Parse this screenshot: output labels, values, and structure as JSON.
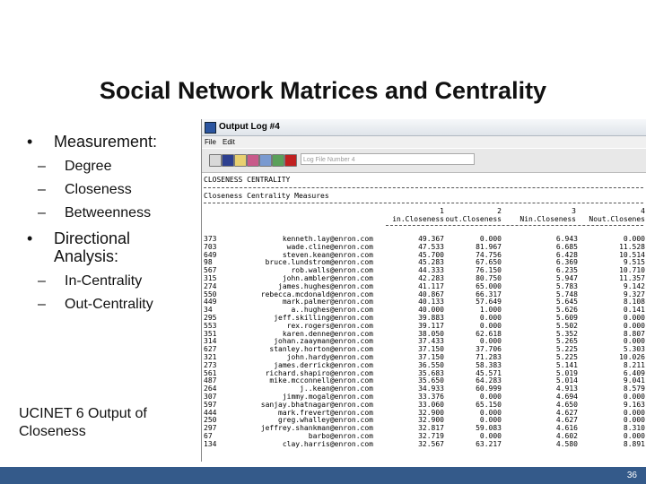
{
  "slide": {
    "title": "Social Network Matrices and Centrality",
    "bullets": [
      {
        "text": "Measurement:",
        "subs": [
          "Degree",
          "Closeness",
          "Betweenness"
        ]
      },
      {
        "text": "Directional Analysis:",
        "subs": [
          "In-Centrality",
          "Out-Centrality"
        ]
      }
    ],
    "caption": "UCINET 6 Output of Closeness",
    "page_number": "36",
    "bullet_glyph": "•",
    "dash_glyph": "–"
  },
  "window": {
    "title": "Output Log #4",
    "menu": [
      "File",
      "Edit"
    ],
    "log_field_placeholder": "Log File Number 4",
    "heading1": "CLOSENESS CENTRALITY",
    "heading2": "Closeness Centrality Measures",
    "column_numbers": [
      "1",
      "2",
      "3",
      "4"
    ],
    "columns": [
      "in.Closeness",
      "out.Closeness",
      "Nin.Closeness",
      "Nout.Closenes"
    ],
    "rows": [
      [
        "373",
        "kenneth.lay@enron.com",
        "49.367",
        "0.000",
        "6.943",
        "0.000"
      ],
      [
        "703",
        "wade.cline@enron.com",
        "47.533",
        "81.967",
        "6.685",
        "11.528"
      ],
      [
        "649",
        "steven.kean@enron.com",
        "45.700",
        "74.756",
        "6.428",
        "10.514"
      ],
      [
        "98",
        "bruce.lundstrom@enron.com",
        "45.283",
        "67.650",
        "6.369",
        "9.515"
      ],
      [
        "567",
        "rob.walls@enron.com",
        "44.333",
        "76.150",
        "6.235",
        "10.710"
      ],
      [
        "315",
        "john.ambler@enron.com",
        "42.283",
        "80.750",
        "5.947",
        "11.357"
      ],
      [
        "274",
        "james.hughes@enron.com",
        "41.117",
        "65.000",
        "5.783",
        "9.142"
      ],
      [
        "550",
        "rebecca.mcdonald@enron.com",
        "40.867",
        "66.317",
        "5.748",
        "9.327"
      ],
      [
        "449",
        "mark.palmer@enron.com",
        "40.133",
        "57.649",
        "5.645",
        "8.108"
      ],
      [
        "34",
        "a..hughes@enron.com",
        "40.000",
        "1.000",
        "5.626",
        "0.141"
      ],
      [
        "295",
        "jeff.skilling@enron.com",
        "39.883",
        "0.000",
        "5.609",
        "0.000"
      ],
      [
        "553",
        "rex.rogers@enron.com",
        "39.117",
        "0.000",
        "5.502",
        "0.000"
      ],
      [
        "351",
        "karen.denne@enron.com",
        "38.050",
        "62.618",
        "5.352",
        "8.807"
      ],
      [
        "314",
        "johan.zaayman@enron.com",
        "37.433",
        "0.000",
        "5.265",
        "0.000"
      ],
      [
        "627",
        "stanley.horton@enron.com",
        "37.150",
        "37.706",
        "5.225",
        "5.303"
      ],
      [
        "321",
        "john.hardy@enron.com",
        "37.150",
        "71.283",
        "5.225",
        "10.026"
      ],
      [
        "273",
        "james.derrick@enron.com",
        "36.550",
        "58.383",
        "5.141",
        "8.211"
      ],
      [
        "561",
        "richard.shapiro@enron.com",
        "35.683",
        "45.571",
        "5.019",
        "6.409"
      ],
      [
        "487",
        "mike.mcconnell@enron.com",
        "35.650",
        "64.283",
        "5.014",
        "9.041"
      ],
      [
        "264",
        "j..kean@enron.com",
        "34.933",
        "60.999",
        "4.913",
        "8.579"
      ],
      [
        "307",
        "jimmy.mogal@enron.com",
        "33.376",
        "0.000",
        "4.694",
        "0.000"
      ],
      [
        "597",
        "sanjay.bhatnagar@enron.com",
        "33.060",
        "65.150",
        "4.650",
        "9.163"
      ],
      [
        "444",
        "mark.frevert@enron.com",
        "32.900",
        "0.000",
        "4.627",
        "0.000"
      ],
      [
        "250",
        "greg.whalley@enron.com",
        "32.900",
        "0.000",
        "4.627",
        "0.000"
      ],
      [
        "297",
        "jeffrey.shankman@enron.com",
        "32.817",
        "59.083",
        "4.616",
        "8.310"
      ],
      [
        "67",
        "barbo@enron.com",
        "32.719",
        "0.000",
        "4.602",
        "0.000"
      ],
      [
        "134",
        "clay.harris@enron.com",
        "32.567",
        "63.217",
        "4.580",
        "8.891"
      ]
    ]
  },
  "colors": {
    "footer": "#345a8a",
    "window_icon": "#2b55a0"
  },
  "icons": [
    "window-app-icon",
    "print-icon",
    "save-icon",
    "open-icon",
    "copy-icon",
    "paste-icon",
    "find-icon",
    "close-icon"
  ]
}
